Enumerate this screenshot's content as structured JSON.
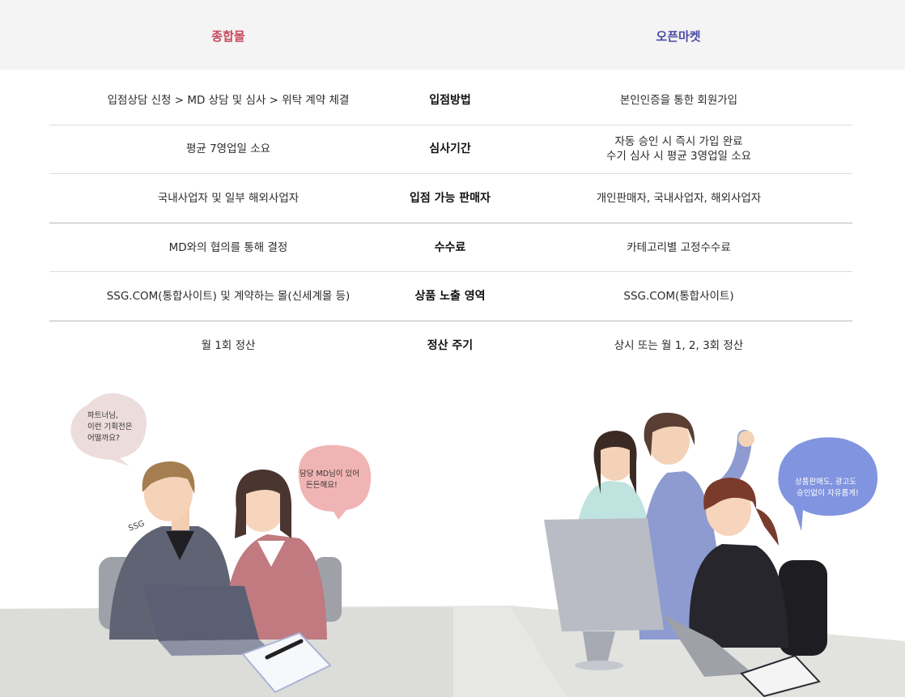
{
  "header": {
    "left_title": "종합몰",
    "right_title": "오픈마켓",
    "left_color": "#c8475c",
    "right_color": "#4a4aa8"
  },
  "rows": [
    {
      "label": "입점방법",
      "left": "입점상담 신청 > MD 상담 및 심사 > 위탁 계약 체결",
      "right": "본인인증을 통한 회원가입"
    },
    {
      "label": "심사기간",
      "left": "평균 7영업일 소요",
      "right": "자동 승인 시 즉시 가입 완료\n수기 심사 시 평균 3영업일 소요"
    },
    {
      "label": "입점 가능 판매자",
      "left": "국내사업자 및 일부 해외사업자",
      "right": "개인판매자, 국내사업자, 해외사업자"
    },
    {
      "label": "수수료",
      "left": "MD와의 협의를 통해 결정",
      "right": "카테고리별 고정수수료"
    },
    {
      "label": "상품 노출 영역",
      "left": "SSG.COM(통합사이트) 및 계약하는 몰(신세계몰 등)",
      "right": "SSG.COM(통합사이트)"
    },
    {
      "label": "정산 주기",
      "left": "월 1회 정산",
      "right": "상시 또는 월 1, 2, 3회 정산"
    }
  ],
  "illustration": {
    "bubble_left_1": [
      "파트너님,",
      "이런 기획전은",
      "어떨까요?"
    ],
    "bubble_left_2": [
      "담당 MD님이 있어",
      "든든해요!"
    ],
    "bubble_right": [
      "상품판매도, 광고도",
      "승인없이 자유롭게!"
    ],
    "badge": "SSG"
  }
}
